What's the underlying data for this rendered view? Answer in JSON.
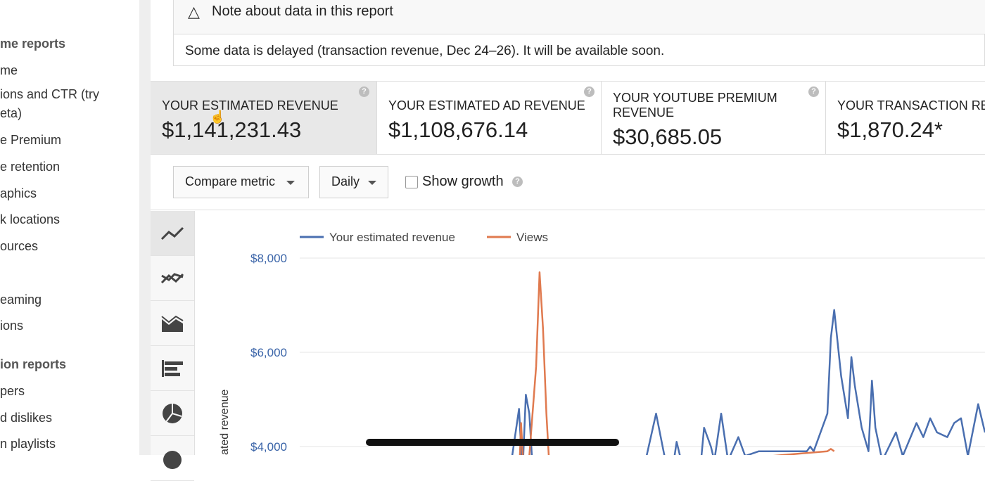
{
  "sidebar": {
    "items": [
      {
        "label": "me reports",
        "header": true
      },
      {
        "label": "me",
        "header": false
      },
      {
        "label": "ions and CTR (try",
        "header": false
      },
      {
        "label": "eta)",
        "header": false
      },
      {
        "label": "e Premium",
        "header": false
      },
      {
        "label": "e retention",
        "header": false
      },
      {
        "label": "aphics",
        "header": false
      },
      {
        "label": "k locations",
        "header": false
      },
      {
        "label": "ources",
        "header": false
      },
      {
        "label": "eaming",
        "header": false
      },
      {
        "label": "ions",
        "header": false
      },
      {
        "label": "ion reports",
        "header": true
      },
      {
        "label": "pers",
        "header": false
      },
      {
        "label": "d dislikes",
        "header": false
      },
      {
        "label": "n playlists",
        "header": false
      }
    ]
  },
  "notice": {
    "icon": "warning-triangle-icon",
    "title": "Note about data in this report",
    "text": "Some data is delayed (transaction revenue, Dec 24–26). It will be available soon."
  },
  "metrics": [
    {
      "label": "YOUR ESTIMATED REVENUE",
      "value": "$1,141,231.43",
      "selected": true
    },
    {
      "label": "YOUR ESTIMATED AD REVENUE",
      "value": "$1,108,676.14",
      "selected": false
    },
    {
      "label": "YOUR YOUTUBE PREMIUM REVENUE",
      "value": "$30,685.05",
      "selected": false
    },
    {
      "label": "YOUR TRANSACTION RE",
      "value": "$1,870.24*",
      "selected": false
    }
  ],
  "controls": {
    "compare_label": "Compare metric",
    "interval_label": "Daily",
    "growth_label": "Show growth"
  },
  "colors": {
    "revenue": "#4a6fb0",
    "views": "#e07a4f",
    "accent": "#3a64a8"
  },
  "chart_data": {
    "type": "line",
    "ylabel": "ated revenue",
    "yticks": [
      "$8,000",
      "$6,000",
      "$4,000"
    ],
    "ylim": [
      3500,
      8800
    ],
    "legend_position": "top-left",
    "grid": true,
    "series": [
      {
        "name": "Your estimated revenue",
        "color": "#4a6fb0",
        "values": [
          {
            "x": 0,
            "y": 2800
          },
          {
            "x": 0.3,
            "y": 2800
          },
          {
            "x": 0.32,
            "y": 4800
          },
          {
            "x": 0.325,
            "y": 3400
          },
          {
            "x": 0.33,
            "y": 5100
          },
          {
            "x": 0.335,
            "y": 4700
          },
          {
            "x": 0.34,
            "y": 3500
          },
          {
            "x": 0.5,
            "y": 3400
          },
          {
            "x": 0.52,
            "y": 4700
          },
          {
            "x": 0.535,
            "y": 3600
          },
          {
            "x": 0.545,
            "y": 3600
          },
          {
            "x": 0.55,
            "y": 4100
          },
          {
            "x": 0.56,
            "y": 3500
          },
          {
            "x": 0.585,
            "y": 3600
          },
          {
            "x": 0.59,
            "y": 4400
          },
          {
            "x": 0.6,
            "y": 4000
          },
          {
            "x": 0.605,
            "y": 3700
          },
          {
            "x": 0.615,
            "y": 4700
          },
          {
            "x": 0.625,
            "y": 3700
          },
          {
            "x": 0.64,
            "y": 4200
          },
          {
            "x": 0.65,
            "y": 3800
          },
          {
            "x": 0.67,
            "y": 3900
          },
          {
            "x": 0.74,
            "y": 3900
          },
          {
            "x": 0.745,
            "y": 4000
          },
          {
            "x": 0.75,
            "y": 3900
          },
          {
            "x": 0.77,
            "y": 4700
          },
          {
            "x": 0.775,
            "y": 6300
          },
          {
            "x": 0.78,
            "y": 6900
          },
          {
            "x": 0.79,
            "y": 5500
          },
          {
            "x": 0.8,
            "y": 4600
          },
          {
            "x": 0.805,
            "y": 5900
          },
          {
            "x": 0.81,
            "y": 5300
          },
          {
            "x": 0.82,
            "y": 4400
          },
          {
            "x": 0.83,
            "y": 3900
          },
          {
            "x": 0.835,
            "y": 5400
          },
          {
            "x": 0.84,
            "y": 4400
          },
          {
            "x": 0.85,
            "y": 3700
          },
          {
            "x": 0.87,
            "y": 4300
          },
          {
            "x": 0.88,
            "y": 3800
          },
          {
            "x": 0.9,
            "y": 4500
          },
          {
            "x": 0.91,
            "y": 4200
          },
          {
            "x": 0.92,
            "y": 4600
          },
          {
            "x": 0.93,
            "y": 4300
          },
          {
            "x": 0.945,
            "y": 4200
          },
          {
            "x": 0.955,
            "y": 4500
          },
          {
            "x": 0.965,
            "y": 4600
          },
          {
            "x": 0.975,
            "y": 3800
          },
          {
            "x": 0.99,
            "y": 4900
          },
          {
            "x": 1.0,
            "y": 4300
          }
        ]
      },
      {
        "name": "Views",
        "color": "#e07a4f",
        "values": [
          {
            "x": 0.32,
            "y": 3300
          },
          {
            "x": 0.323,
            "y": 4500
          },
          {
            "x": 0.327,
            "y": 3400
          },
          {
            "x": 0.33,
            "y": 3800
          },
          {
            "x": 0.333,
            "y": 3400
          },
          {
            "x": 0.345,
            "y": 5700
          },
          {
            "x": 0.35,
            "y": 7700
          },
          {
            "x": 0.355,
            "y": 6500
          },
          {
            "x": 0.36,
            "y": 4700
          },
          {
            "x": 0.365,
            "y": 3400
          },
          {
            "x": 0.77,
            "y": 3900
          },
          {
            "x": 0.775,
            "y": 3950
          },
          {
            "x": 0.78,
            "y": 3900
          }
        ]
      }
    ]
  }
}
